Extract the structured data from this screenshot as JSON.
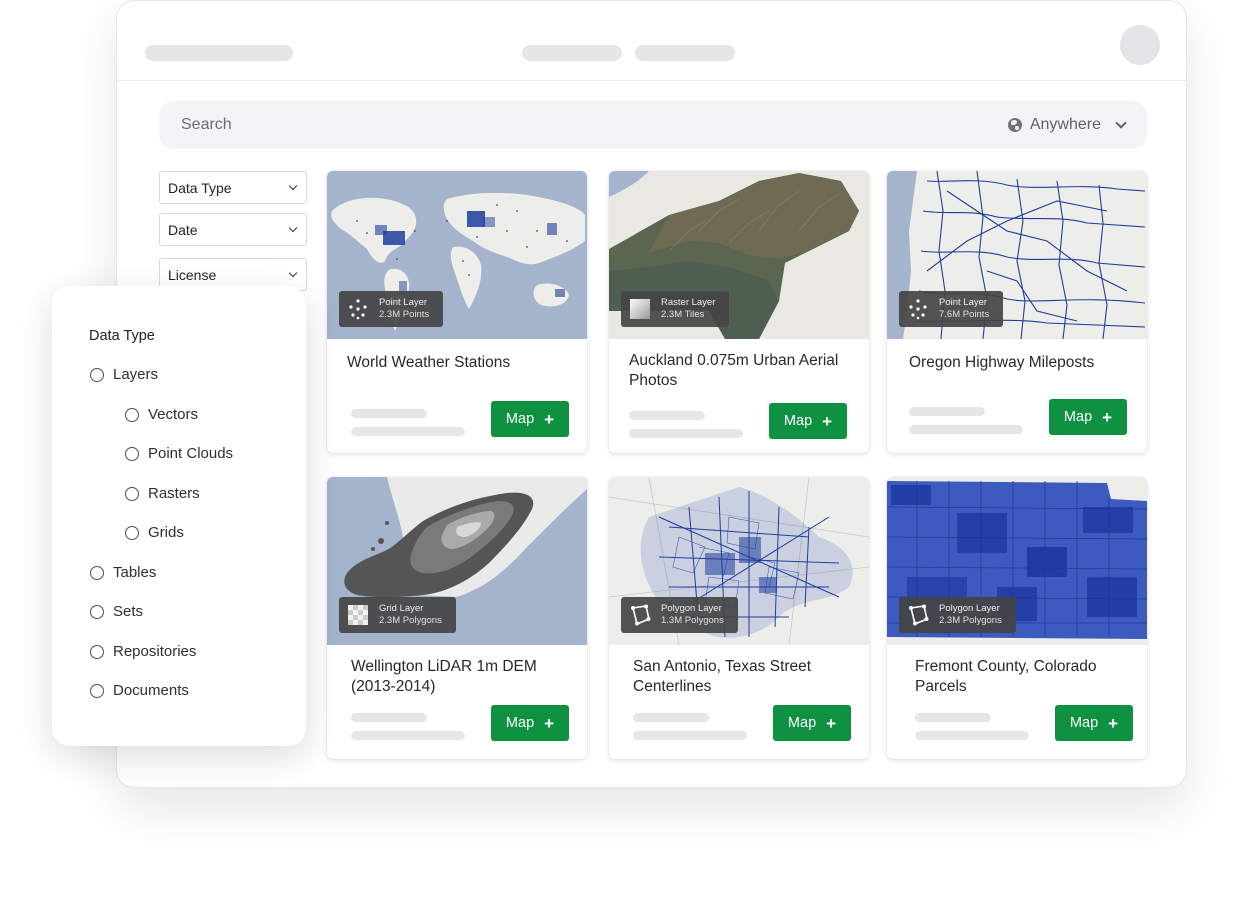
{
  "search": {
    "placeholder": "Search",
    "location_label": "Anywhere"
  },
  "filters": [
    {
      "label": "Data Type"
    },
    {
      "label": "Date"
    },
    {
      "label": "License"
    }
  ],
  "filter_panel": {
    "title": "Data Type",
    "options": [
      {
        "label": "Layers",
        "level": 0
      },
      {
        "label": "Vectors",
        "level": 1
      },
      {
        "label": "Point Clouds",
        "level": 1
      },
      {
        "label": "Rasters",
        "level": 1
      },
      {
        "label": "Grids",
        "level": 1
      },
      {
        "label": "Tables",
        "level": 0
      },
      {
        "label": "Sets",
        "level": 0
      },
      {
        "label": "Repositories",
        "level": 0
      },
      {
        "label": "Documents",
        "level": 0
      }
    ]
  },
  "cards": [
    {
      "title": "World Weather Stations",
      "layer_type": "Point Layer",
      "count": "2.3M Points",
      "icon": "point-layer-icon",
      "button": "Map"
    },
    {
      "title": "Auckland 0.075m Urban Aerial Photos",
      "layer_type": "Raster Layer",
      "count": "2.3M Tiles",
      "icon": "raster-layer-icon",
      "button": "Map"
    },
    {
      "title": "Oregon Highway Mileposts",
      "layer_type": "Point Layer",
      "count": "7.6M Points",
      "icon": "point-layer-icon",
      "button": "Map"
    },
    {
      "title": "Wellington LiDAR 1m DEM (2013-2014)",
      "layer_type": "Grid Layer",
      "count": "2.3M Polygons",
      "icon": "grid-layer-icon",
      "button": "Map"
    },
    {
      "title": "San Antonio, Texas Street Centerlines",
      "layer_type": "Polygon Layer",
      "count": "1.3M Polygons",
      "icon": "polygon-layer-icon",
      "button": "Map"
    },
    {
      "title": "Fremont County, Colorado Parcels",
      "layer_type": "Polygon Layer",
      "count": "2.3M Polygons",
      "icon": "polygon-layer-icon",
      "button": "Map"
    }
  ],
  "colors": {
    "accent_green": "#0f9142",
    "map_water": "#a3b4cc",
    "map_land": "#ededea",
    "data_blue": "#1f3d9e"
  }
}
